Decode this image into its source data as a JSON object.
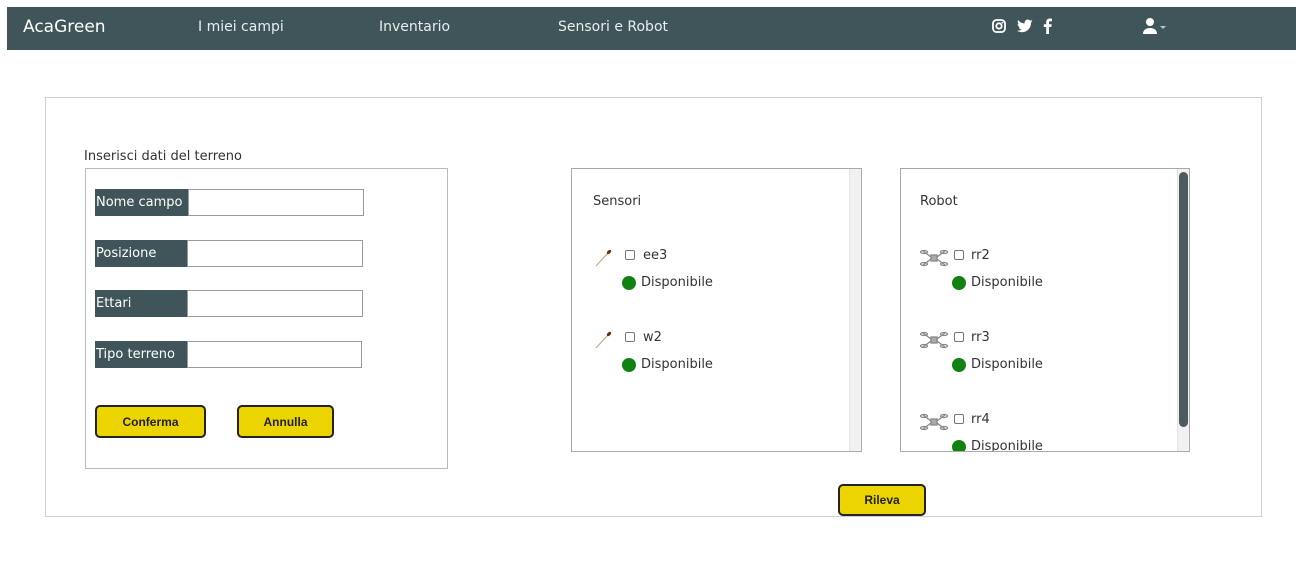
{
  "navbar": {
    "brand": "AcaGreen",
    "links": [
      "I miei campi",
      "Inventario",
      "Sensori e Robot"
    ],
    "social_icons": [
      "instagram-icon",
      "twitter-icon",
      "facebook-icon"
    ],
    "user_icon": "user-icon"
  },
  "form": {
    "caption": "Inserisci dati del terreno",
    "fields": [
      {
        "label": "Nome campo",
        "value": ""
      },
      {
        "label": "Posizione",
        "value": ""
      },
      {
        "label": "Ettari",
        "value": ""
      },
      {
        "label": "Tipo terreno",
        "value": ""
      }
    ],
    "confirm_label": "Conferma",
    "cancel_label": "Annulla"
  },
  "sensors": {
    "title": "Sensori",
    "items": [
      {
        "name": "ee3",
        "status": "Disponibile"
      },
      {
        "name": "w2",
        "status": "Disponibile"
      }
    ]
  },
  "robots": {
    "title": "Robot",
    "items": [
      {
        "name": "rr2",
        "status": "Disponibile"
      },
      {
        "name": "rr3",
        "status": "Disponibile"
      },
      {
        "name": "rr4",
        "status": "Disponibile"
      }
    ]
  },
  "detect_label": "Rileva",
  "colors": {
    "navbar": "#3f5559",
    "button": "#ecd400",
    "available": "#118211"
  }
}
